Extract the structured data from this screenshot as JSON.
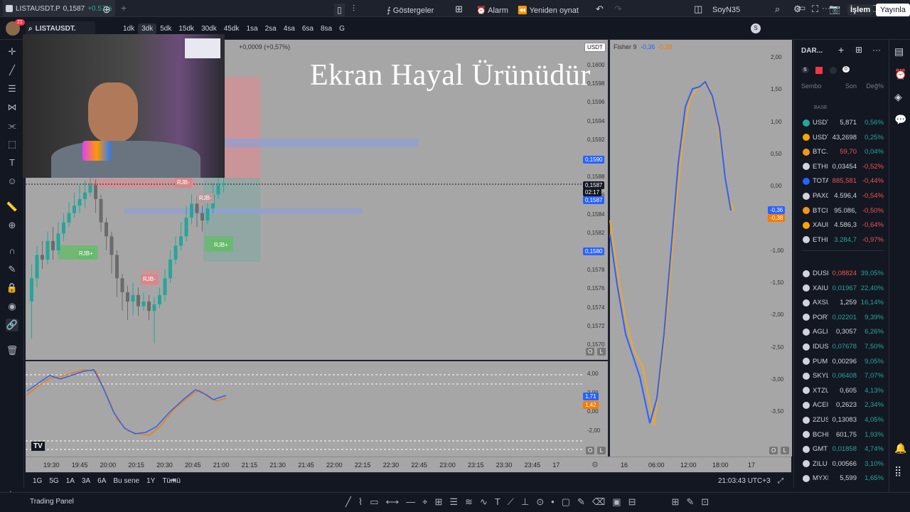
{
  "tab": {
    "title": "LISTAUSDT.P",
    "price": "0,1587",
    "change": "+0.57%"
  },
  "toolbar": {
    "symbol": "LISTAUSDT.",
    "intervals": [
      "1dk",
      "3dk",
      "5dk",
      "15dk",
      "30dk",
      "45dk",
      "1sa",
      "2sa",
      "4sa",
      "6sa",
      "8sa",
      "G"
    ],
    "selected_interval": "3dk",
    "indicators": "Göstergeler",
    "alarm": "Alarm",
    "replay": "Yeniden oynat",
    "layout_name": "SoyN35",
    "layout_badge": "S",
    "trade": "İşlem",
    "publish": "Yayınla"
  },
  "notification_count": "21",
  "watermark": "Ekran Hayal Ürünüdür",
  "main_chart": {
    "change_line": "+0,0009 (+0,57%)",
    "currency": "USDT",
    "price_axis": [
      "0,1600",
      "0,1598",
      "0,1596",
      "0,1594",
      "0,1592",
      "0,1590",
      "0,1588",
      "0,1586",
      "0,1584",
      "0,1582",
      "0,1580",
      "0,1578",
      "0,1576",
      "0,1574",
      "0,1572",
      "0,1570"
    ],
    "tag_blue_top": "0,1590",
    "tag_last_price": "0,1587",
    "tag_countdown": "02:17",
    "tag_last_price_2": "0,1587",
    "tag_blue_bottom": "0,1580",
    "labels": {
      "rjb_minus": "RJB-",
      "rjb_plus": "RJB+"
    }
  },
  "sub_chart": {
    "axis": [
      "4,00",
      "2,00",
      "0,00",
      "-2,00"
    ],
    "tag_blue": "1,71",
    "tag_orange": "1,42"
  },
  "right_chart": {
    "title": "Fisher 9",
    "value_blue": "-0,36",
    "value_orange": "-0,38",
    "axis": [
      "2,00",
      "1,50",
      "1,00",
      "0,50",
      "0,00",
      "-0,50",
      "-1,00",
      "-1,50",
      "-2,00",
      "-2,50",
      "-3,00",
      "-3,50"
    ],
    "tag_blue": "-0,36",
    "tag_orange": "-0,38",
    "x_ticks": [
      "16",
      "06:00",
      "12:00",
      "18:00",
      "17"
    ]
  },
  "x_axis": [
    "19:30",
    "19:45",
    "20:00",
    "20:15",
    "20:30",
    "20:45",
    "21:00",
    "21:15",
    "21:30",
    "21:45",
    "22:00",
    "22:15",
    "22:30",
    "22:45",
    "23:00",
    "23:15",
    "23:30",
    "23:45",
    "17"
  ],
  "ranges": [
    "1G",
    "5G",
    "1A",
    "3A",
    "6A",
    "Bu sene",
    "1Y",
    "Tümü"
  ],
  "clock": "21:03:43 UTC+3",
  "panel_label": "Trading Panel",
  "logo": "TV",
  "scale_buttons": {
    "auto": "O",
    "log": "L"
  },
  "watchlist": {
    "title": "DAR...",
    "badge_s": "S",
    "badge_zero": "0",
    "columns": [
      "Sembo",
      "Son",
      "Değ%"
    ],
    "section": "BASE",
    "rows_base": [
      {
        "sym": "USDT",
        "last": "5,871",
        "chg": "0,56%",
        "lc": "neu",
        "cc": "pos",
        "icon": "#26a69a"
      },
      {
        "sym": "USDT",
        "last": "43,2698",
        "chg": "0,25%",
        "lc": "neu",
        "cc": "pos",
        "icon": "#f7a600"
      },
      {
        "sym": "BTC.",
        "last": "59,70",
        "chg": "0,04%",
        "lc": "neg",
        "cc": "pos",
        "icon": "#f7931a"
      },
      {
        "sym": "ETHI",
        "last": "0,03454",
        "chg": "-0,52%",
        "lc": "neu",
        "cc": "neg",
        "icon": "#d1d4dc"
      },
      {
        "sym": "TOTA",
        "last": "885,581",
        "chg": "-0,44%",
        "lc": "neg",
        "cc": "neg",
        "icon": "#2962ff"
      },
      {
        "sym": "PAXG",
        "last": "4.596,4",
        "chg": "-0,54%",
        "lc": "neu",
        "cc": "neg",
        "icon": "#d1d4dc"
      },
      {
        "sym": "BTCI",
        "last": "95.086,",
        "chg": "-0,50%",
        "lc": "neu",
        "cc": "neg",
        "icon": "#f7931a"
      },
      {
        "sym": "XAUI",
        "last": "4.586,3",
        "chg": "-0,64%",
        "lc": "neu",
        "cc": "neg",
        "icon": "#f7a600"
      },
      {
        "sym": "ETHI",
        "last": "3.284,7",
        "chg": "-0,97%",
        "lc": "pos",
        "cc": "neg",
        "icon": "#d1d4dc"
      }
    ],
    "rows_other": [
      {
        "sym": "DUSI",
        "last": "0,08824",
        "chg": "39,05%",
        "lc": "neg",
        "cc": "pos"
      },
      {
        "sym": "XAIU",
        "last": "0,01967",
        "chg": "22,40%",
        "lc": "pos",
        "cc": "pos"
      },
      {
        "sym": "AXSU",
        "last": "1,259",
        "chg": "16,14%",
        "lc": "neu",
        "cc": "pos"
      },
      {
        "sym": "PORT",
        "last": "0,02201",
        "chg": "9,39%",
        "lc": "pos",
        "cc": "pos"
      },
      {
        "sym": "AGLI",
        "last": "0,3057",
        "chg": "6,26%",
        "lc": "neu",
        "cc": "pos"
      },
      {
        "sym": "IDUS",
        "last": "0,07678",
        "chg": "7,50%",
        "lc": "pos",
        "cc": "pos"
      },
      {
        "sym": "PUM",
        "last": "0,00296",
        "chg": "9,05%",
        "lc": "neu",
        "cc": "pos"
      },
      {
        "sym": "SKYL",
        "last": "0,06408",
        "chg": "7,07%",
        "lc": "pos",
        "cc": "pos"
      },
      {
        "sym": "XTZU",
        "last": "0,605",
        "chg": "4,13%",
        "lc": "neu",
        "cc": "pos"
      },
      {
        "sym": "ACEI",
        "last": "0,2623",
        "chg": "2,34%",
        "lc": "neu",
        "cc": "pos"
      },
      {
        "sym": "2ZUS",
        "last": "0,13083",
        "chg": "4,05%",
        "lc": "neu",
        "cc": "pos"
      },
      {
        "sym": "BCHI",
        "last": "601,75",
        "chg": "1,93%",
        "lc": "neu",
        "cc": "pos"
      },
      {
        "sym": "GMT",
        "last": "0,01858",
        "chg": "4,74%",
        "lc": "pos",
        "cc": "pos"
      },
      {
        "sym": "ZILU",
        "last": "0,00566",
        "chg": "3,10%",
        "lc": "neu",
        "cc": "pos"
      },
      {
        "sym": "MYXI",
        "last": "5,599",
        "chg": "1,65%",
        "lc": "neu",
        "cc": "pos"
      }
    ]
  }
}
